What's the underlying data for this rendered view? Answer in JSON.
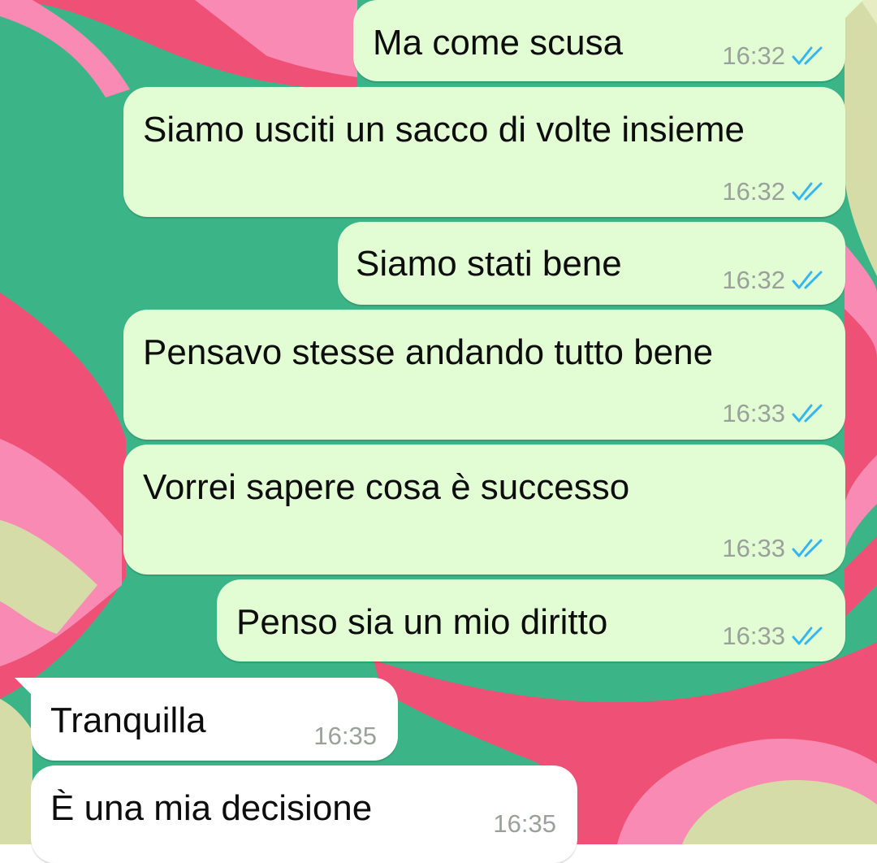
{
  "conversation": {
    "messages": [
      {
        "direction": "outgoing",
        "text": "Ma come scusa",
        "time": "16:32",
        "status_icon": "double-check-read-icon"
      },
      {
        "direction": "outgoing",
        "text": "Siamo usciti un sacco di volte insieme",
        "time": "16:32",
        "status_icon": "double-check-read-icon"
      },
      {
        "direction": "outgoing",
        "text": "Siamo stati bene",
        "time": "16:32",
        "status_icon": "double-check-read-icon"
      },
      {
        "direction": "outgoing",
        "text": "Pensavo stesse andando tutto bene",
        "time": "16:33",
        "status_icon": "double-check-read-icon"
      },
      {
        "direction": "outgoing",
        "text": "Vorrei sapere cosa è successo",
        "time": "16:33",
        "status_icon": "double-check-read-icon"
      },
      {
        "direction": "outgoing",
        "text": "Penso sia un mio diritto",
        "time": "16:33",
        "status_icon": "double-check-read-icon"
      },
      {
        "direction": "incoming",
        "text": "Tranquilla",
        "time": "16:35"
      },
      {
        "direction": "incoming",
        "text": "È una mia decisione",
        "time": "16:35"
      }
    ]
  },
  "colors": {
    "outgoing_bubble": "#e2fdd4",
    "incoming_bubble": "#ffffff",
    "read_check": "#34b7f1",
    "wallpaper_green": "#3bb487",
    "wallpaper_red": "#ef5176",
    "wallpaper_pink": "#f88ab4",
    "wallpaper_cream": "#d6dca8"
  }
}
